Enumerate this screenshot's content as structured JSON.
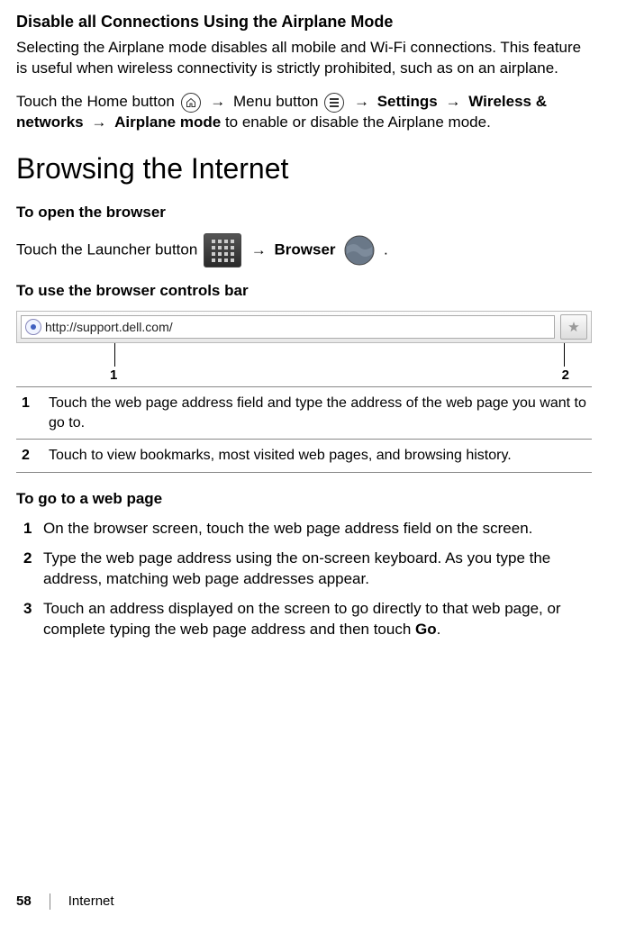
{
  "section1": {
    "title": "Disable all Connections Using the Airplane Mode",
    "para": "Selecting the Airplane mode disables all mobile and Wi-Fi connections. This feature is useful when wireless connectivity is strictly prohibited, such as on an airplane.",
    "instr_pre": "Touch the Home button ",
    "instr_mid1": " Menu button ",
    "instr_b1": "Settings",
    "instr_b2": "Wireless & networks",
    "instr_b3": "Airplane mode",
    "instr_post": " to enable or disable the Airplane mode."
  },
  "heading_main": "Browsing the Internet",
  "open_browser": {
    "title": "To open the browser",
    "pre": "Touch the Launcher button ",
    "b1": "Browser"
  },
  "controls": {
    "title": "To use the browser controls bar",
    "url": "http://support.dell.com/",
    "c1_num": "1",
    "c2_num": "2",
    "rows": [
      {
        "n": "1",
        "t": "Touch the web page address field and type the address of the web page you want to go to."
      },
      {
        "n": "2",
        "t": "Touch to view bookmarks, most visited web pages, and browsing history."
      }
    ]
  },
  "goto": {
    "title": "To go to a web page",
    "steps": [
      {
        "n": "1",
        "t": "On the browser screen, touch the web page address field on the screen."
      },
      {
        "n": "2",
        "t": "Type the web page address using the on-screen keyboard. As you type the address, matching web page addresses appear."
      },
      {
        "n": "3",
        "t_pre": "Touch an address displayed on the screen to go directly to that web page, or complete typing the web page address and then touch ",
        "t_b": "Go",
        "t_post": "."
      }
    ]
  },
  "footer": {
    "page": "58",
    "section": "Internet"
  },
  "arrow": "→"
}
